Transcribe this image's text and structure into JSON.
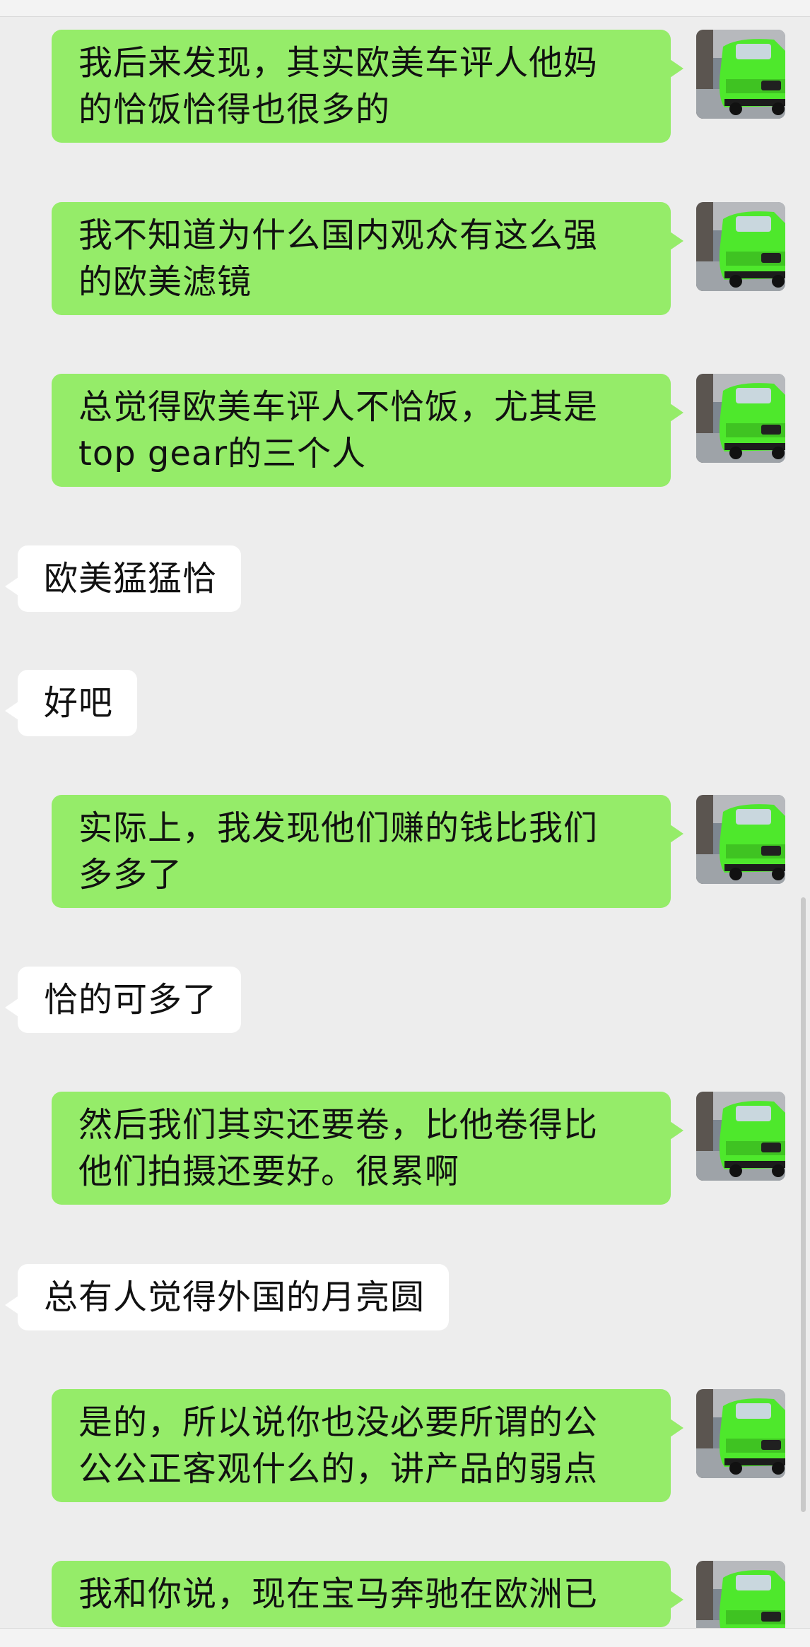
{
  "chat": {
    "messages": [
      {
        "side": "me",
        "lines": [
          "我后来发现，其实欧美车评人他妈",
          "的恰饭恰得也很多的"
        ]
      },
      {
        "side": "me",
        "lines": [
          "我不知道为什么国内观众有这么强",
          "的欧美滤镜"
        ]
      },
      {
        "side": "me",
        "lines": [
          "总觉得欧美车评人不恰饭，尤其是",
          "top gear的三个人"
        ]
      },
      {
        "side": "them",
        "lines": [
          "欧美猛猛恰"
        ]
      },
      {
        "side": "them",
        "lines": [
          "好吧"
        ]
      },
      {
        "side": "me",
        "lines": [
          "实际上，我发现他们赚的钱比我们",
          "多多了"
        ]
      },
      {
        "side": "them",
        "lines": [
          "恰的可多了"
        ]
      },
      {
        "side": "me",
        "lines": [
          "然后我们其实还要卷，比他卷得比",
          "他们拍摄还要好。很累啊"
        ]
      },
      {
        "side": "them",
        "lines": [
          "总有人觉得外国的月亮圆"
        ]
      },
      {
        "side": "me",
        "lines": [
          "是的，所以说你也没必要所谓的公",
          "公公正客观什么的，讲产品的弱点"
        ]
      },
      {
        "side": "me",
        "lines": [
          "我和你说，现在宝马奔驰在欧洲已",
          ""
        ]
      }
    ]
  },
  "colors": {
    "background": "#ededed",
    "my_bubble": "#95ec69",
    "their_bubble": "#ffffff",
    "avatar_car": "#4ee82c"
  },
  "icons": {
    "avatar": "green-sports-car-avatar"
  }
}
